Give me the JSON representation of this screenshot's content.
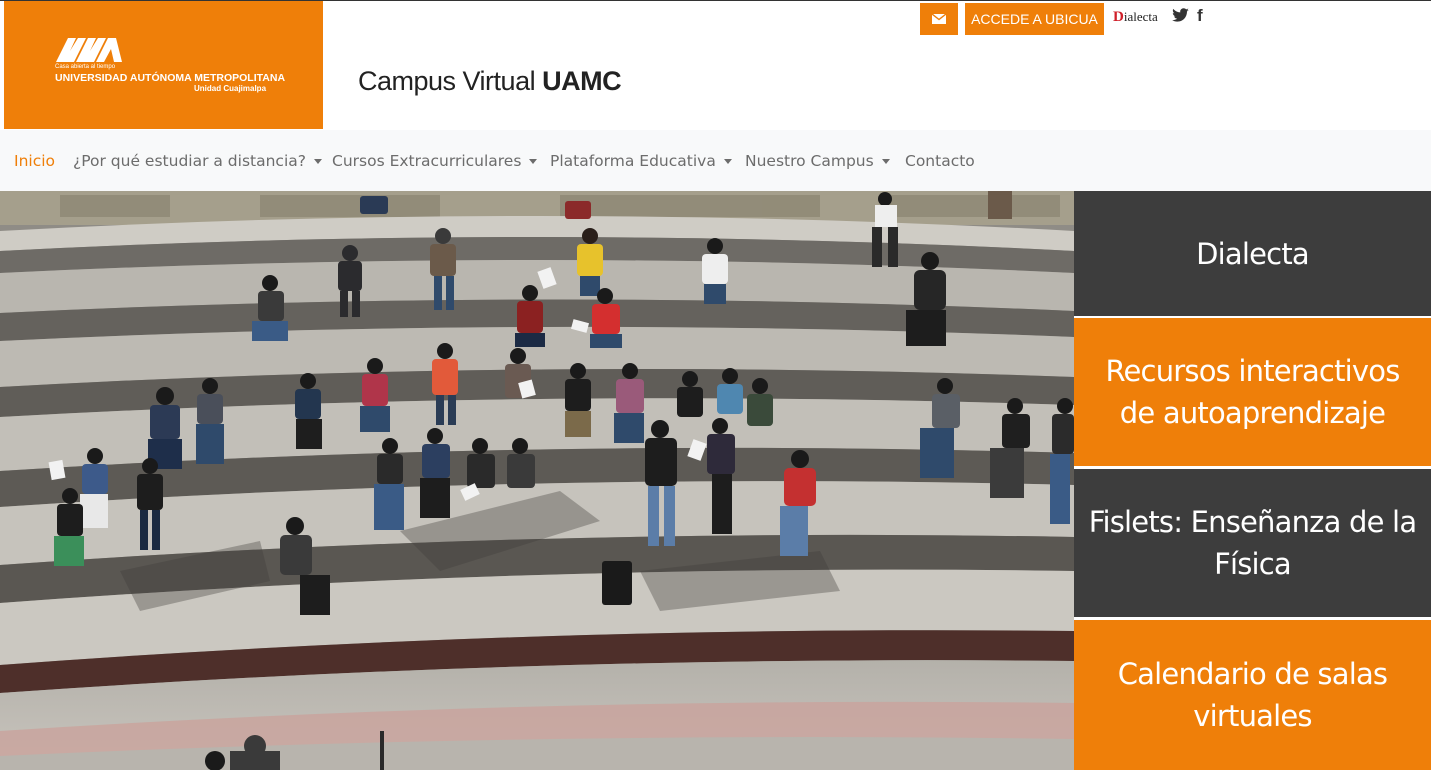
{
  "header": {
    "logo": {
      "tagline": "Casa abierta al tiempo",
      "name": "UNIVERSIDAD AUTÓNOMA METROPOLITANA",
      "unit": "Unidad Cuajimalpa"
    },
    "title_light": "Campus Virtual ",
    "title_bold": "UAMC",
    "mail_icon": "envelope-icon",
    "ubicua_label": "ACCEDE A UBICUA",
    "dialecta_d": "D",
    "dialecta_rest": "ialecta",
    "twitter_icon": "twitter-icon",
    "facebook_icon": "f"
  },
  "nav": {
    "items": [
      {
        "label": "Inicio",
        "active": true,
        "dropdown": false
      },
      {
        "label": "¿Por qué estudiar a distancia?",
        "dropdown": true
      },
      {
        "label": "Cursos Extracurriculares",
        "dropdown": true
      },
      {
        "label": "Plataforma Educativa",
        "dropdown": true
      },
      {
        "label": "Nuestro Campus",
        "dropdown": true
      },
      {
        "label": "Contacto",
        "dropdown": false
      }
    ]
  },
  "tiles": [
    {
      "label": "Dialecta",
      "color": "#3d3d3d"
    },
    {
      "label": "Recursos interactivos de autoaprendizaje",
      "color": "#ef7f09"
    },
    {
      "label": "Fislets: Enseñanza de la Física",
      "color": "#3d3d3d"
    },
    {
      "label": "Calendario de salas virtuales",
      "color": "#ef7f09"
    }
  ],
  "colors": {
    "brand_orange": "#ef7f09",
    "tile_dark": "#3d3d3d",
    "nav_bg": "#f8f9fa"
  }
}
